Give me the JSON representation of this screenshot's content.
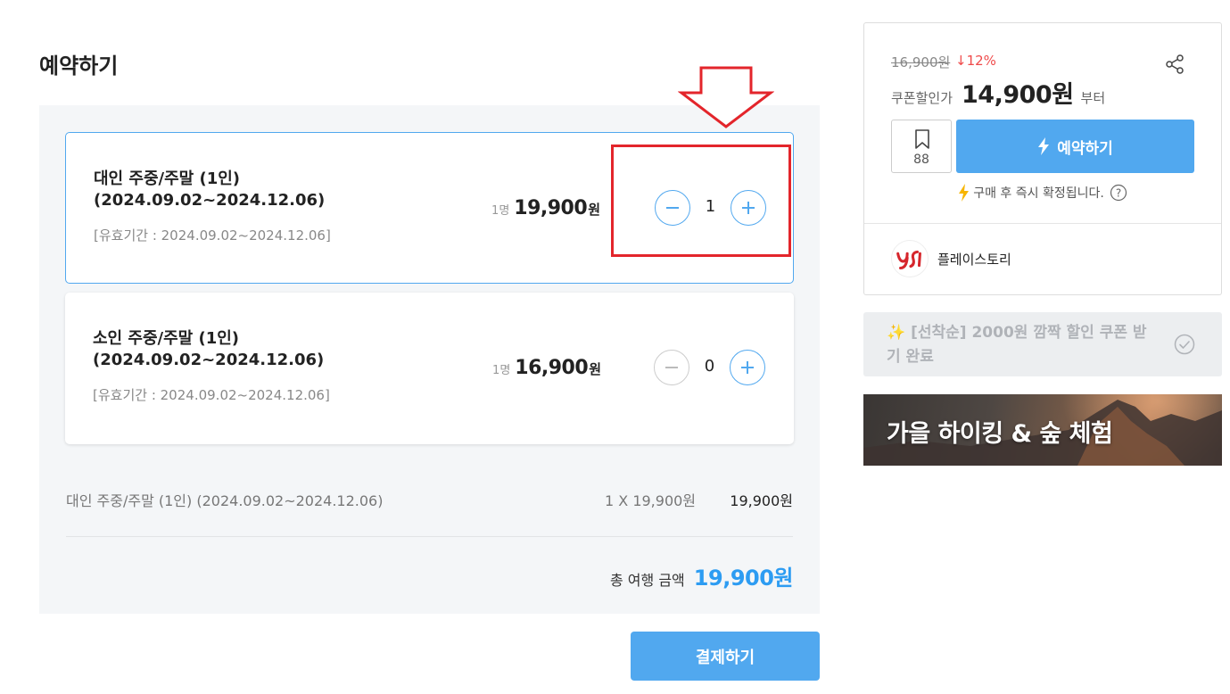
{
  "page": {
    "title": "예약하기"
  },
  "options": [
    {
      "name_line1": "대인 주중/주말 (1인)",
      "name_line2": "(2024.09.02~2024.12.06)",
      "validity": "[유효기간 : 2024.09.02~2024.12.06]",
      "unit": "1명",
      "price": "19,900",
      "currency": "원",
      "quantity": "1"
    },
    {
      "name_line1": "소인 주중/주말 (1인)",
      "name_line2": "(2024.09.02~2024.12.06)",
      "validity": "[유효기간 : 2024.09.02~2024.12.06]",
      "unit": "1명",
      "price": "16,900",
      "currency": "원",
      "quantity": "0"
    }
  ],
  "summary": {
    "item_name": "대인 주중/주말 (1인) (2024.09.02~2024.12.06)",
    "qty_price": "1 X 19,900원",
    "item_total": "19,900원",
    "total_label": "총 여행 금액",
    "total_amount": "19,900원"
  },
  "pay_button": "결제하기",
  "side": {
    "original_price": "16,900원",
    "discount": "↓12%",
    "coupon_label": "쿠폰할인가",
    "coupon_price": "14,900원",
    "coupon_suffix": "부터",
    "bookmark_count": "88",
    "reserve_label": "예약하기",
    "instant_note": "구매 후 즉시 확정됩니다.",
    "seller_name": "플레이스토리"
  },
  "coupon_box": {
    "text": "✨ [선착순] 2000원 깜짝 할인 쿠폰 받기 완료"
  },
  "banner": {
    "text": "가을 하이킹 & 숲 체험"
  },
  "colors": {
    "accent": "#51a8ef",
    "total": "#2d9cf2",
    "discount": "#ef4a4a",
    "highlight": "#e3252b",
    "bolt": "#f7b500"
  },
  "icons": [
    "minus-icon",
    "plus-icon",
    "share-icon",
    "bookmark-icon",
    "bolt-icon",
    "help-icon",
    "check-circle-icon",
    "down-arrow-annotation"
  ]
}
